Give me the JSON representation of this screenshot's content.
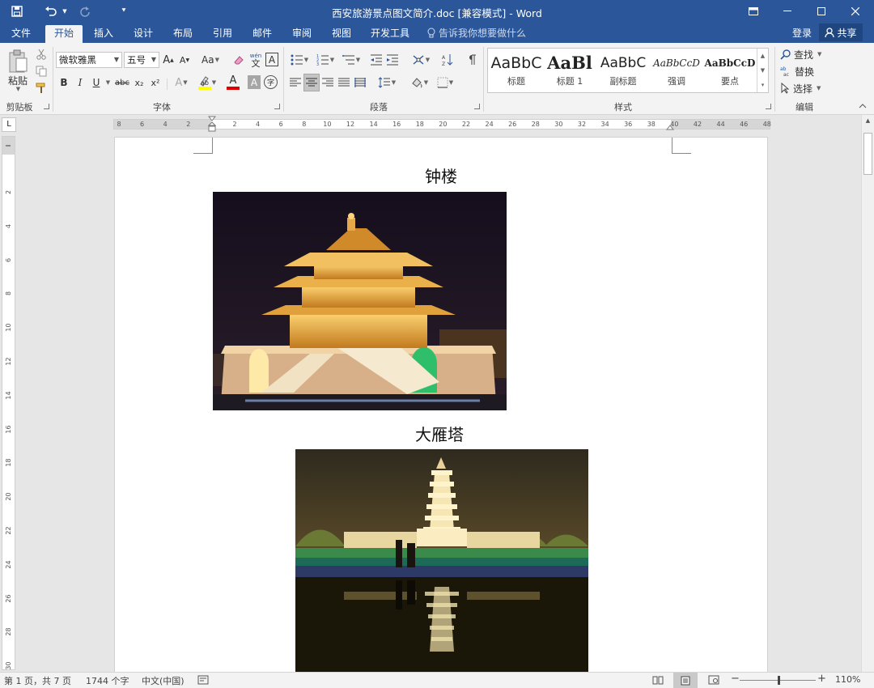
{
  "window": {
    "title": "西安旅游景点图文简介.doc [兼容模式] - Word"
  },
  "tabs": [
    "文件",
    "开始",
    "插入",
    "设计",
    "布局",
    "引用",
    "邮件",
    "审阅",
    "视图",
    "开发工具"
  ],
  "active_tab": "开始",
  "tell_me": "告诉我你想要做什么",
  "account": {
    "login": "登录",
    "share": "共享"
  },
  "ribbon": {
    "clipboard": {
      "label": "剪贴板",
      "paste": "粘贴"
    },
    "font": {
      "label": "字体",
      "font_name": "微软雅黑",
      "font_size": "五号",
      "grow": "A",
      "shrink": "A",
      "change_case": "Aa",
      "phonetic_top": "wén",
      "phonetic_bottom": "文",
      "char_border": "A",
      "bold": "B",
      "italic": "I",
      "underline": "U",
      "strike": "abc",
      "subscript": "x₂",
      "superscript": "x²",
      "text_effects": "A",
      "font_color": "A",
      "char_shading": "A",
      "enclose": "字"
    },
    "paragraph": {
      "label": "段落"
    },
    "styles": {
      "label": "样式",
      "items": [
        {
          "sample": "AaBbC",
          "name": "标题"
        },
        {
          "sample": "AaBl",
          "name": "标题 1"
        },
        {
          "sample": "AaBbC",
          "name": "副标题"
        },
        {
          "sample": "AaBbCcD",
          "name": "强调"
        },
        {
          "sample": "AaBbCcD",
          "name": "要点"
        }
      ]
    },
    "editing": {
      "label": "编辑",
      "find": "查找",
      "replace": "替换",
      "select": "选择"
    }
  },
  "hruler_ticks": [
    "8",
    "6",
    "4",
    "2",
    "",
    "2",
    "4",
    "6",
    "8",
    "10",
    "12",
    "14",
    "16",
    "18",
    "20",
    "22",
    "24",
    "26",
    "28",
    "30",
    "32",
    "34",
    "36",
    "38",
    "40",
    "42",
    "44",
    "46",
    "48"
  ],
  "vruler_ticks": [
    "2",
    "4",
    "6",
    "8",
    "10",
    "12",
    "14",
    "16",
    "18",
    "20",
    "22",
    "24",
    "26",
    "28",
    "30"
  ],
  "document": {
    "sections": [
      {
        "heading": "钟楼",
        "image": "illuminated bell tower at night"
      },
      {
        "heading": "大雁塔",
        "image": "giant wild goose pagoda at night with reflection"
      }
    ]
  },
  "status": {
    "page": "第 1 页，共 7 页",
    "words": "1744 个字",
    "language": "中文(中国)",
    "zoom": "110%"
  },
  "colors": {
    "accent": "#2b579a"
  }
}
